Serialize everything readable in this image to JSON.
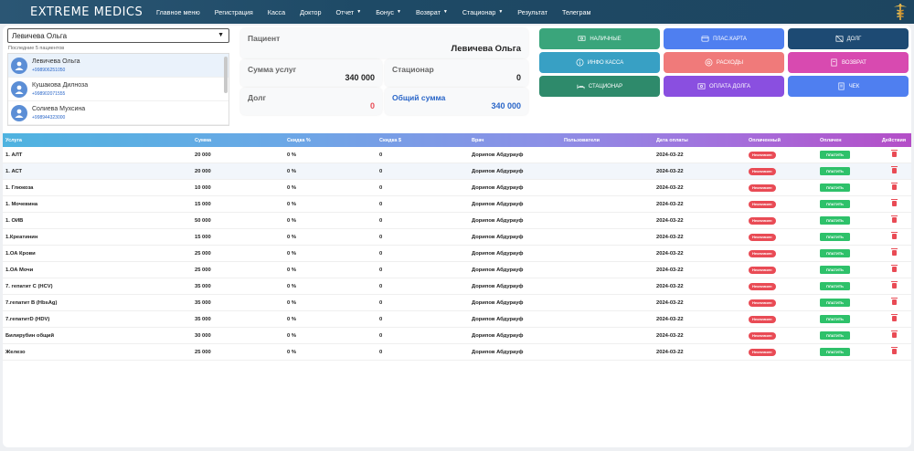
{
  "brand": "EXTREME MEDICS",
  "nav": [
    {
      "label": "Главное меню",
      "dropdown": false
    },
    {
      "label": "Регистрация",
      "dropdown": false
    },
    {
      "label": "Касса",
      "dropdown": false
    },
    {
      "label": "Доктор",
      "dropdown": false
    },
    {
      "label": "Отчет",
      "dropdown": true
    },
    {
      "label": "Бонус",
      "dropdown": true
    },
    {
      "label": "Возврат",
      "dropdown": true
    },
    {
      "label": "Стационар",
      "dropdown": true
    },
    {
      "label": "Результат",
      "dropdown": false
    },
    {
      "label": "Телеграм",
      "dropdown": false
    }
  ],
  "patient_select": {
    "value": "Левичева Ольга"
  },
  "recent": {
    "label": "Последние 5 пациентов",
    "items": [
      {
        "name": "Левичева Ольга",
        "phone": "+998906251050"
      },
      {
        "name": "Кушакова Дилноза",
        "phone": "+998902071555"
      },
      {
        "name": "Солиева Мухсина",
        "phone": "+998944323000"
      }
    ]
  },
  "cards": {
    "patient": {
      "label": "Пациент",
      "value": "Левичева Ольга"
    },
    "services": {
      "label": "Сумма услуг",
      "value": "340 000"
    },
    "inpatient": {
      "label": "Стационар",
      "value": "0"
    },
    "debt": {
      "label": "Долг",
      "value": "0"
    },
    "total": {
      "label": "Общий сумма",
      "value": "340 000"
    }
  },
  "buttons": [
    {
      "label": "НАЛИЧНЫЕ",
      "icon": "cash-icon",
      "color": "#3aa57b"
    },
    {
      "label": "ПЛАС.КАРТА",
      "icon": "card-icon",
      "color": "#4f7ff0"
    },
    {
      "label": "ДОЛГ",
      "icon": "debt-icon",
      "color": "#1d4a73"
    },
    {
      "label": "ИНФО КАССА",
      "icon": "info-icon",
      "color": "#38a0c4"
    },
    {
      "label": "РАСХОДЫ",
      "icon": "expense-icon",
      "color": "#f07a7a"
    },
    {
      "label": "ВОЗВРАТ",
      "icon": "return-icon",
      "color": "#d84ab0"
    },
    {
      "label": "СТАЦИОНАР",
      "icon": "bed-icon",
      "color": "#2e8a6b"
    },
    {
      "label": "ОПЛАТА ДОЛГА",
      "icon": "pay-debt-icon",
      "color": "#8a4fe0"
    },
    {
      "label": "ЧЕК",
      "icon": "receipt-icon",
      "color": "#4f7ff0"
    }
  ],
  "table": {
    "headers": [
      "Услуга",
      "Сумма",
      "Скидка %",
      "Скидка $",
      "Врач",
      "Пользователи",
      "Дата оплаты",
      "Оплаченный",
      "Оплачен",
      "Действия"
    ],
    "badge_label": "Неоплачен",
    "pay_label": "ПЛАТИТЬ",
    "rows": [
      {
        "service": "1. АЛТ",
        "sum": "20 000",
        "disc_pct": "0 %",
        "disc_amt": "0",
        "doctor": "Дорипов Абдурауф",
        "user": "",
        "date": "2024-03-22"
      },
      {
        "service": "1. АСТ",
        "sum": "20 000",
        "disc_pct": "0 %",
        "disc_amt": "0",
        "doctor": "Дорипов Абдурауф",
        "user": "",
        "date": "2024-03-22"
      },
      {
        "service": "1. Глюкоза",
        "sum": "10 000",
        "disc_pct": "0 %",
        "disc_amt": "0",
        "doctor": "Дорипов Абдурауф",
        "user": "",
        "date": "2024-03-22"
      },
      {
        "service": "1. Мочевина",
        "sum": "15 000",
        "disc_pct": "0 %",
        "disc_amt": "0",
        "doctor": "Дорипов Абдурауф",
        "user": "",
        "date": "2024-03-22"
      },
      {
        "service": "1. ОИВ",
        "sum": "50 000",
        "disc_pct": "0 %",
        "disc_amt": "0",
        "doctor": "Дорипов Абдурауф",
        "user": "",
        "date": "2024-03-22"
      },
      {
        "service": "1.Креатинин",
        "sum": "15 000",
        "disc_pct": "0 %",
        "disc_amt": "0",
        "doctor": "Дорипов Абдурауф",
        "user": "",
        "date": "2024-03-22"
      },
      {
        "service": "1.ОА Крови",
        "sum": "25 000",
        "disc_pct": "0 %",
        "disc_amt": "0",
        "doctor": "Дорипов Абдурауф",
        "user": "",
        "date": "2024-03-22"
      },
      {
        "service": "1.ОА Мочи",
        "sum": "25 000",
        "disc_pct": "0 %",
        "disc_amt": "0",
        "doctor": "Дорипов Абдурауф",
        "user": "",
        "date": "2024-03-22"
      },
      {
        "service": "7. гепатит С (HCV)",
        "sum": "35 000",
        "disc_pct": "0 %",
        "disc_amt": "0",
        "doctor": "Дорипов Абдурауф",
        "user": "",
        "date": "2024-03-22"
      },
      {
        "service": "7.гепатит В (HbsAg)",
        "sum": "35 000",
        "disc_pct": "0 %",
        "disc_amt": "0",
        "doctor": "Дорипов Абдурауф",
        "user": "",
        "date": "2024-03-22"
      },
      {
        "service": "7.гепатитD (HDV)",
        "sum": "35 000",
        "disc_pct": "0 %",
        "disc_amt": "0",
        "doctor": "Дорипов Абдурауф",
        "user": "",
        "date": "2024-03-22"
      },
      {
        "service": "Билирубин общий",
        "sum": "30 000",
        "disc_pct": "0 %",
        "disc_amt": "0",
        "doctor": "Дорипов Абдурауф",
        "user": "",
        "date": "2024-03-22"
      },
      {
        "service": "Железо",
        "sum": "25 000",
        "disc_pct": "0 %",
        "disc_amt": "0",
        "doctor": "Дорипов Абдурауф",
        "user": "",
        "date": "2024-03-22"
      }
    ]
  },
  "colors": {
    "debt_value": "#e94b55",
    "total_value": "#2a66c8"
  }
}
